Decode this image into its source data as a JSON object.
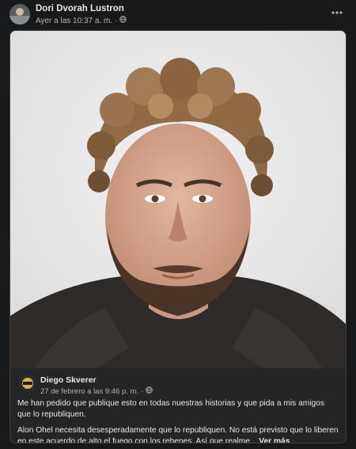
{
  "post": {
    "author": "Dori Dvorah Lustron",
    "timestamp": "Ayer a las 10:37 a. m.",
    "separator": "·",
    "audience_icon": "globe-icon",
    "more_icon": "more-options-icon"
  },
  "shared": {
    "author": "Diego Skverer",
    "timestamp": "27 de febrero a las 9:46 p. m.",
    "separator": "·",
    "audience_icon": "globe-icon",
    "paragraph1": "Me han pedido que publique esto en todas nuestras historias y que pida a mis amigos que lo republiquen.",
    "paragraph2": "Alon Ohel necesita desesperadamente que lo republiquen. No está previsto que lo liberen en este acuerdo de alto el fuego con los rehenes. Así que realme...",
    "see_more": "Ver más"
  },
  "colors": {
    "background": "#18191a",
    "card": "#242526",
    "text_primary": "#e4e6eb",
    "text_secondary": "#b0b3b8"
  }
}
